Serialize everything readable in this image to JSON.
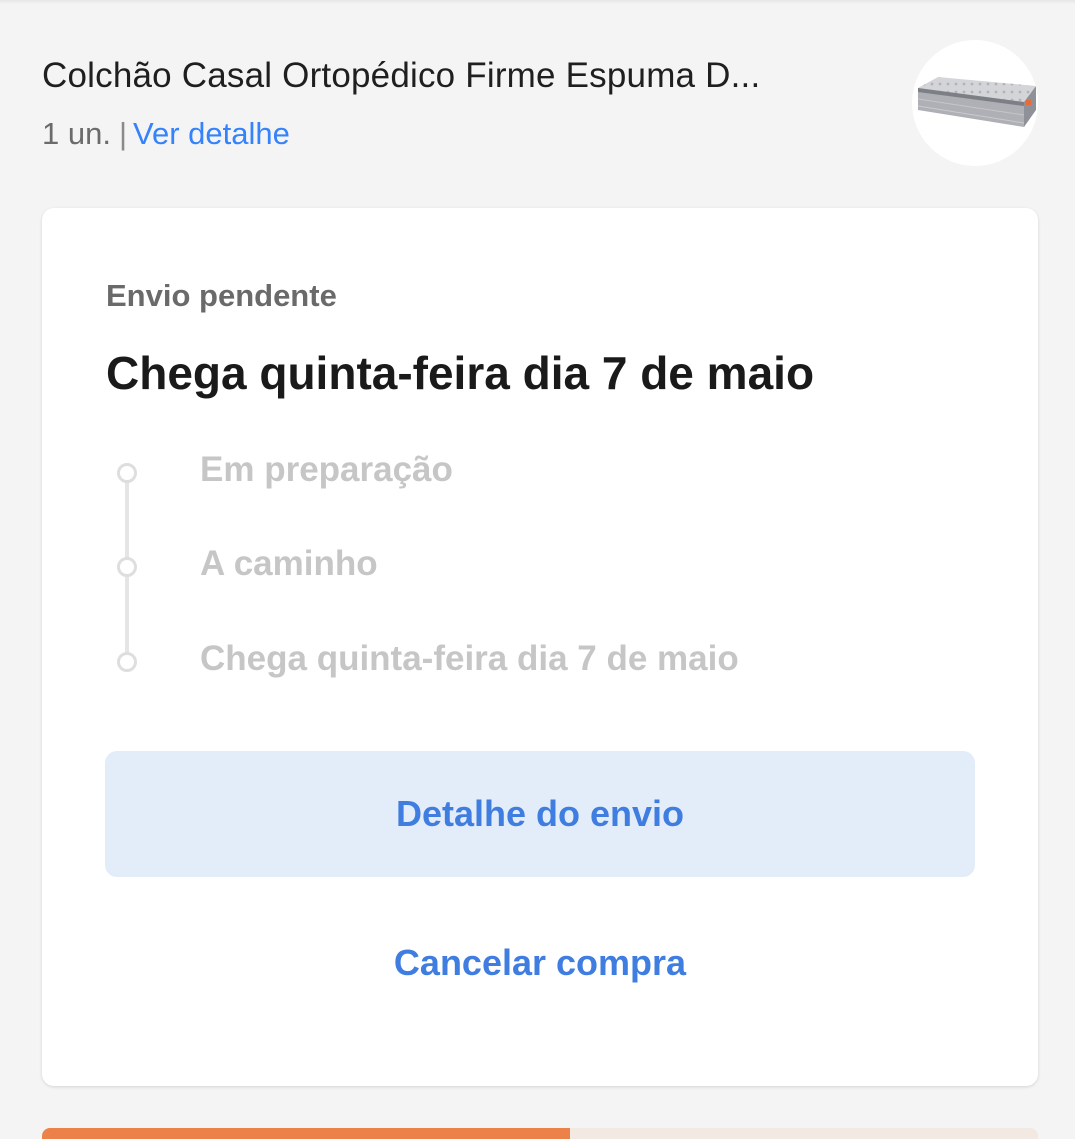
{
  "product": {
    "title": "Colchão Casal Ortopédico Firme Espuma D...",
    "quantity": "1 un.",
    "separator": "|",
    "detail_link": "Ver detalhe",
    "image_icon": "mattress-image"
  },
  "shipment": {
    "status_label": "Envio pendente",
    "headline": "Chega quinta-feira dia 7 de maio",
    "steps": [
      {
        "label": "Em preparação"
      },
      {
        "label": "A caminho"
      },
      {
        "label": "Chega quinta-feira dia 7 de maio"
      }
    ],
    "primary_button": "Detalhe do envio",
    "cancel_button": "Cancelar compra"
  },
  "colors": {
    "accent": "#3483fa",
    "button_bg": "#e3ecf9",
    "progress_orange": "#ec8149",
    "inactive_step": "#c6c6c6"
  },
  "bottom_progress": {
    "fraction": 0.53
  }
}
